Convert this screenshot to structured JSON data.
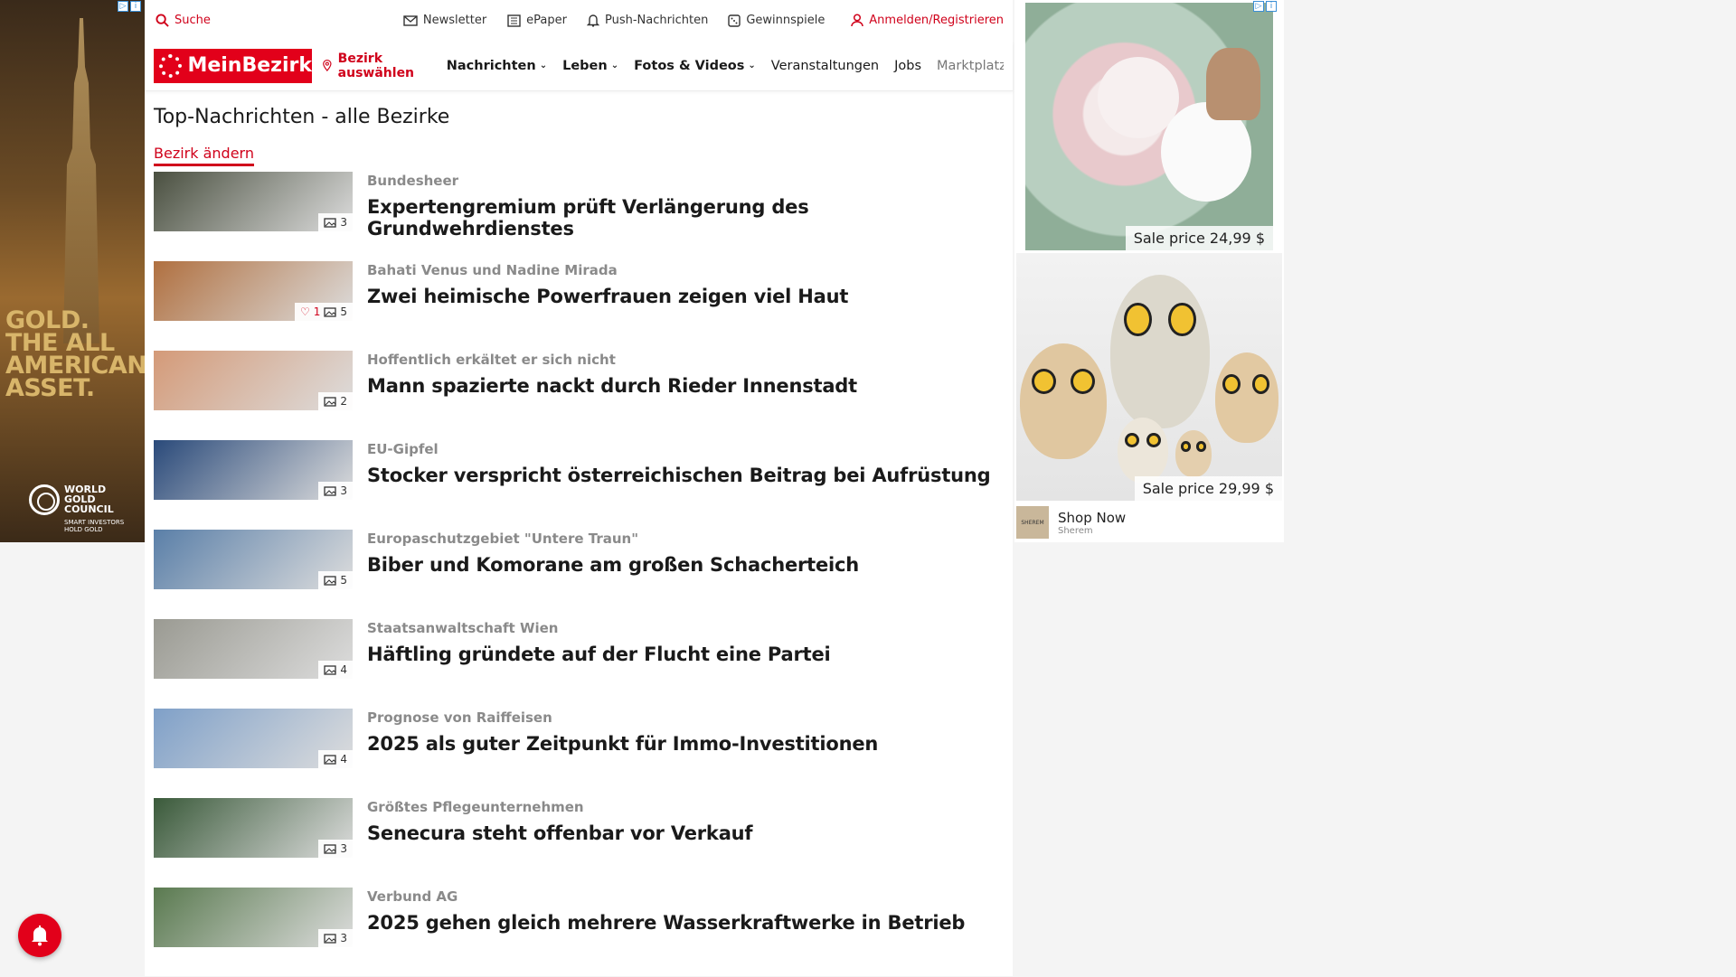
{
  "topbar": {
    "search_label": "Suche",
    "links": [
      {
        "label": "Newsletter",
        "icon": "mail-icon"
      },
      {
        "label": "ePaper",
        "icon": "newspaper-icon"
      },
      {
        "label": "Push-Nachrichten",
        "icon": "bell-icon"
      },
      {
        "label": "Gewinnspiele",
        "icon": "dice-icon"
      }
    ],
    "login_label": "Anmelden/Registrieren"
  },
  "navbar": {
    "logo_text": "MeinBezirk",
    "bezirk_select": "Bezirk auswählen",
    "items": [
      {
        "label": "Nachrichten",
        "dropdown": true
      },
      {
        "label": "Leben",
        "dropdown": true
      },
      {
        "label": "Fotos & Videos",
        "dropdown": true
      },
      {
        "label": "Veranstaltungen"
      },
      {
        "label": "Jobs"
      },
      {
        "label": "Marktplatz"
      }
    ]
  },
  "main": {
    "title": "Top-Nachrichten - alle Bezirke",
    "change_district": "Bezirk ändern",
    "articles": [
      {
        "kicker": "Bundesheer",
        "headline": "Expertengremium prüft Verlängerung des Grundwehrdienstes",
        "photos": "3",
        "likes": null,
        "thumb_color": "#4a5040"
      },
      {
        "kicker": "Bahati Venus und Nadine Mirada",
        "headline": "Zwei heimische Powerfrauen zeigen viel Haut",
        "photos": "5",
        "likes": "1",
        "thumb_color": "#b07040"
      },
      {
        "kicker": "Hoffentlich erkältet er sich nicht",
        "headline": "Mann spazierte nackt durch Rieder Innenstadt",
        "photos": "2",
        "likes": null,
        "thumb_color": "#d49a78"
      },
      {
        "kicker": "EU-Gipfel",
        "headline": "Stocker verspricht österreichischen Beitrag bei Aufrüstung",
        "photos": "3",
        "likes": null,
        "thumb_color": "#2a4a7a"
      },
      {
        "kicker": "Europaschutzgebiet \"Untere Traun\"",
        "headline": "Biber und Komorane am großen Schacherteich",
        "photos": "5",
        "likes": null,
        "thumb_color": "#5a7fa8"
      },
      {
        "kicker": "Staatsanwaltschaft Wien",
        "headline": "Häftling gründete auf der Flucht eine Partei",
        "photos": "4",
        "likes": null,
        "thumb_color": "#9a9a92"
      },
      {
        "kicker": "Prognose von Raiffeisen",
        "headline": "2025 als guter Zeitpunkt für Immo-Investitionen",
        "photos": "4",
        "likes": null,
        "thumb_color": "#7fa0c8"
      },
      {
        "kicker": "Größtes Pflegeunternehmen",
        "headline": "Senecura steht offenbar vor Verkauf",
        "photos": "3",
        "likes": null,
        "thumb_color": "#3a5a3a"
      },
      {
        "kicker": "Verbund AG",
        "headline": "2025 gehen gleich mehrere Wasserkraftwerke in Betrieb",
        "photos": "3",
        "likes": null,
        "thumb_color": "#5a7a50"
      }
    ]
  },
  "ad_left": {
    "headline_lines": [
      "GOLD.",
      "THE ALL",
      "AMERICAN",
      "ASSET."
    ],
    "brand_lines": [
      "WORLD",
      "GOLD",
      "COUNCIL"
    ],
    "tagline_lines": [
      "SMART INVESTORS",
      "HOLD GOLD"
    ]
  },
  "ad_right": {
    "price1": "Sale price 24,99 $",
    "price2": "Sale price 29,99 $",
    "cta": "Shop Now",
    "brand": "Sherem",
    "brand_logo_text": "SHEREM"
  },
  "colors": {
    "brand": "#e2001a",
    "link": "#d0021b"
  }
}
